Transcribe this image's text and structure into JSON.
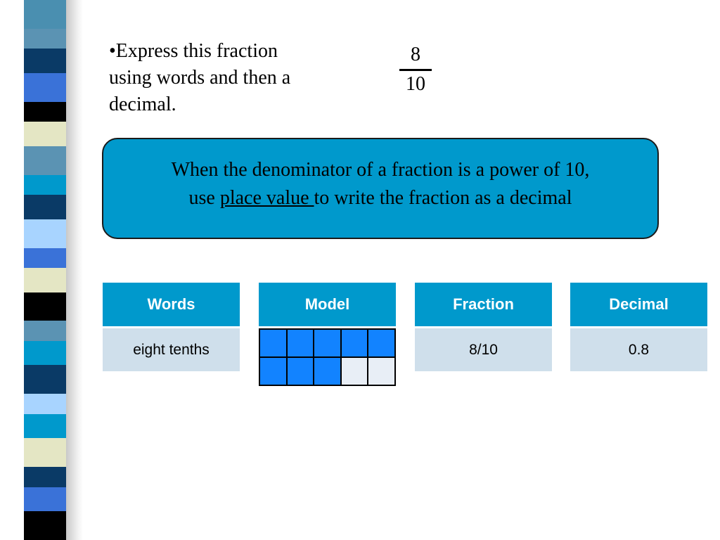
{
  "decor": {
    "strip_colors": [
      "#4a8fb0",
      "#5b93b3",
      "#0a3a66",
      "#3a72d8",
      "#000000",
      "#e4e6c4",
      "#5b93b3",
      "#0099cc",
      "#0a3a66",
      "#a8d4ff",
      "#3a72d8",
      "#e4e6c4",
      "#000000",
      "#5b93b3",
      "#0099cc",
      "#0a3a66",
      "#a8d4ff",
      "#0099cc",
      "#e4e6c4",
      "#0a3a66",
      "#3a72d8",
      "#000000"
    ]
  },
  "prompt": {
    "text_line1": "•Express this fraction",
    "text_line2": "using words and then a",
    "text_line3": "decimal."
  },
  "fraction": {
    "numerator": "8",
    "denominator": "10"
  },
  "callout": {
    "line1": "When the denominator of a fraction is a power of 10,",
    "line2_pre": "use ",
    "line2_underlined": "place value ",
    "line2_post": "to write the fraction as a decimal",
    "color": "#0099cc"
  },
  "table": {
    "words": {
      "header": "Words",
      "value": "eight tenths"
    },
    "model": {
      "header": "Model",
      "shaded_cells": 8,
      "total_cells": 10
    },
    "fraction": {
      "header": "Fraction",
      "value": "8/10"
    },
    "decimal": {
      "header": "Decimal",
      "value": "0.8"
    },
    "header_color": "#0099cc",
    "cell_color": "#cfdfeb"
  }
}
